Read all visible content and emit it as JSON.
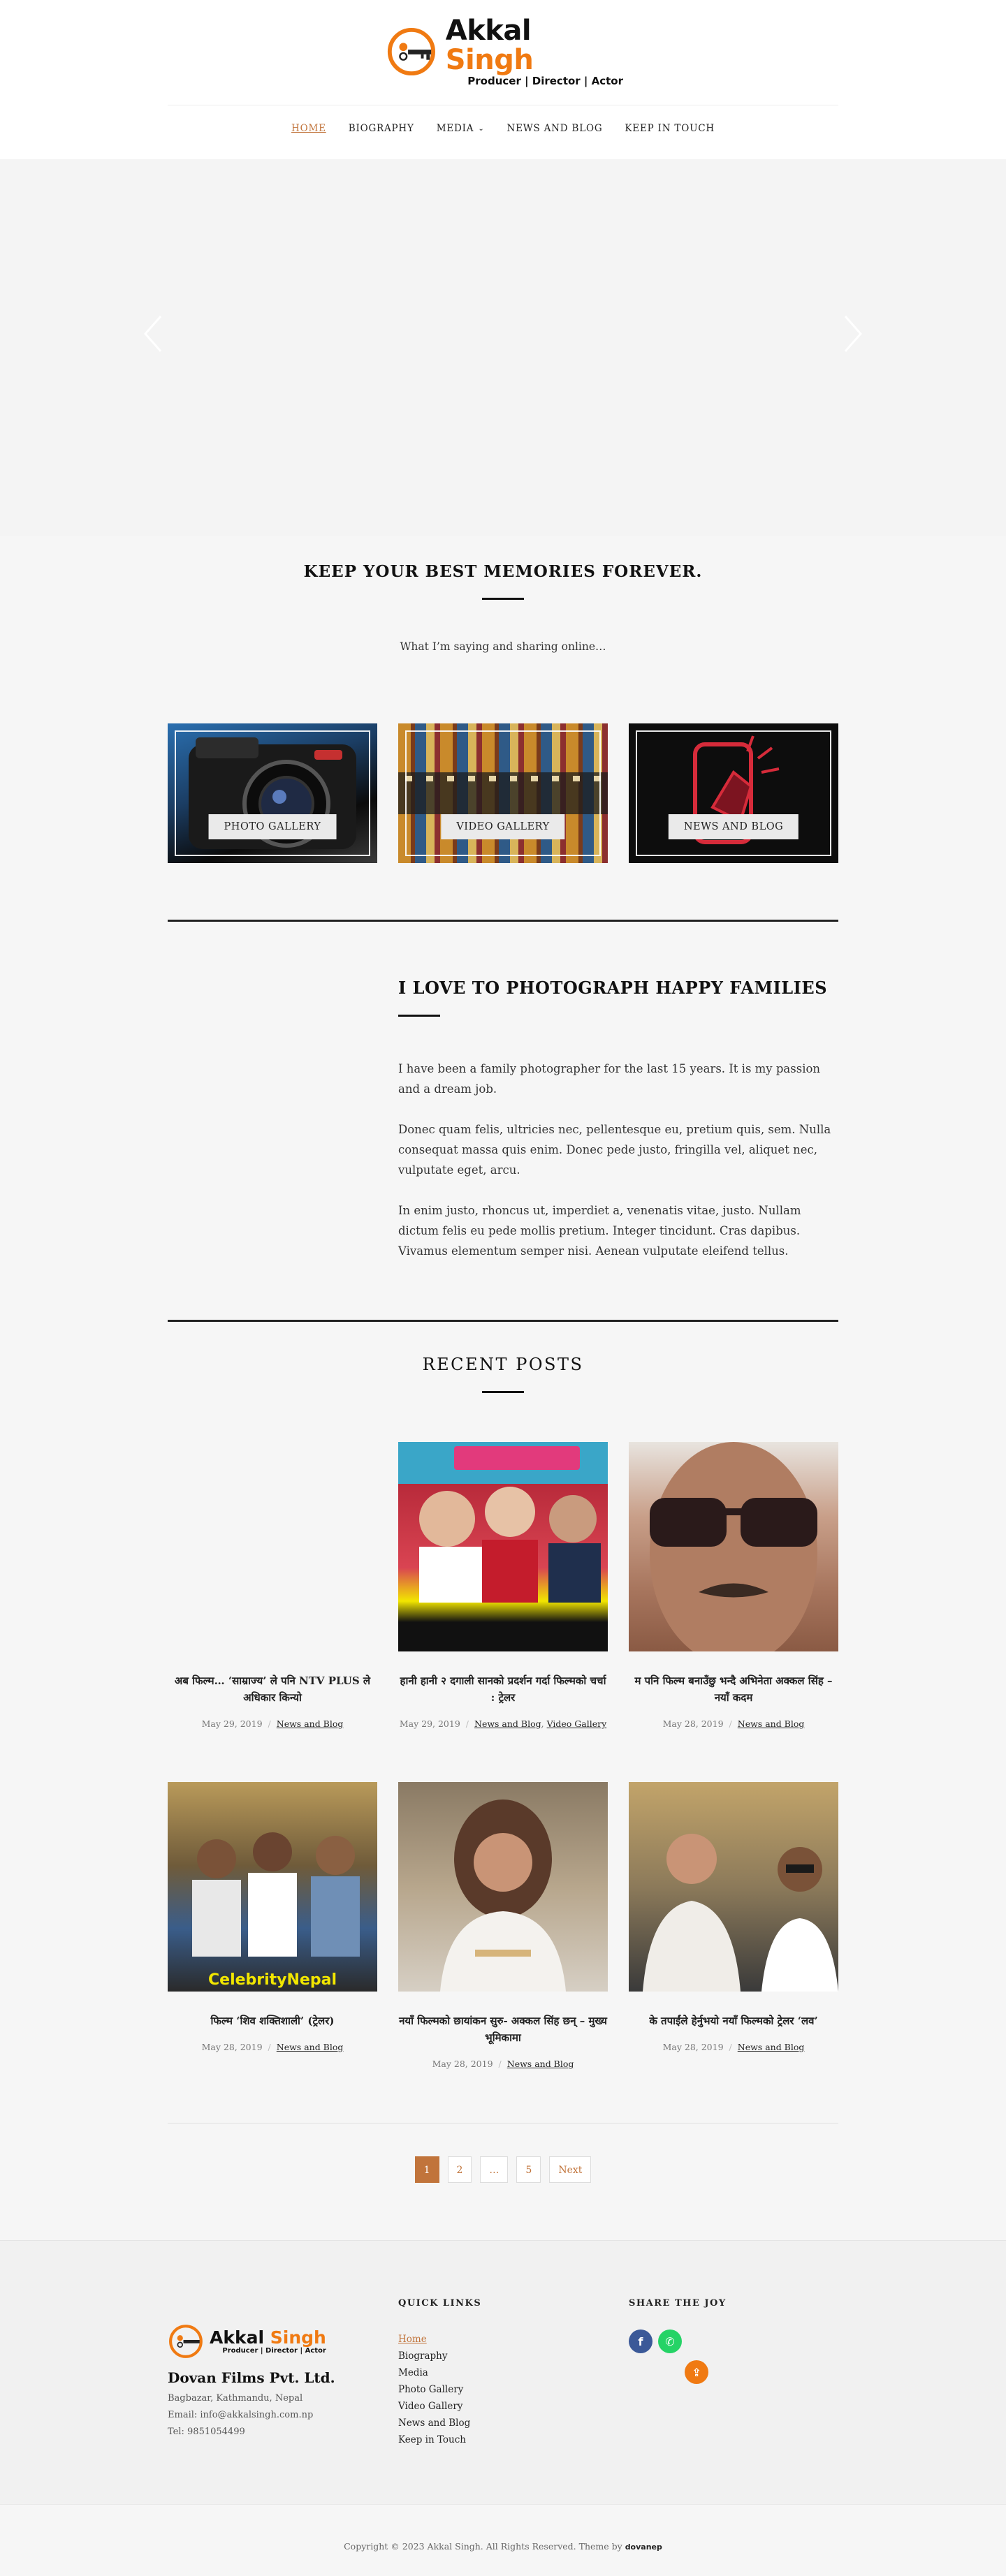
{
  "brand": {
    "name_part1": "Akkal",
    "name_part2": "Singh",
    "tagline": "Producer | Director | Actor",
    "accent_color": "#f07a12",
    "link_color": "#c1743b"
  },
  "nav": {
    "items": [
      {
        "label": "HOME",
        "active": true
      },
      {
        "label": "BIOGRAPHY"
      },
      {
        "label": "MEDIA",
        "has_dropdown": true
      },
      {
        "label": "NEWS AND BLOG"
      },
      {
        "label": "KEEP IN TOUCH"
      }
    ]
  },
  "memories": {
    "title": "KEEP YOUR BEST MEMORIES FOREVER.",
    "subtitle": "What I’m saying and sharing online…"
  },
  "tiles": [
    {
      "label": "PHOTO GALLERY"
    },
    {
      "label": "VIDEO GALLERY"
    },
    {
      "label": "NEWS AND BLOG"
    }
  ],
  "love": {
    "title": "I LOVE TO PHOTOGRAPH HAPPY FAMILIES",
    "paragraphs": [
      "I have been a family photographer for the last 15 years. It is my passion and a dream job.",
      "Donec quam felis, ultricies nec, pellentesque eu, pretium quis, sem. Nulla consequat massa quis enim. Donec pede justo, fringilla vel, aliquet nec, vulputate eget, arcu.",
      "In enim justo, rhoncus ut, imperdiet a, venenatis vitae, justo. Nullam dictum felis eu pede mollis pretium. Integer tincidunt. Cras dapibus. Vivamus elementum semper nisi. Aenean vulputate eleifend tellus."
    ]
  },
  "recent": {
    "title": "RECENT POSTS",
    "posts": [
      {
        "title": "अब फिल्म… ‘साम्राज्य’ ले पनि NTV PLUS ले अधिकार किन्यो",
        "date": "May 29, 2019",
        "cats": [
          "News and Blog"
        ]
      },
      {
        "title": "हानी हानी २ दगाली सानको प्रदर्शन गर्दा फिल्मको चर्चा : ट्रेलर",
        "date": "May 29, 2019",
        "cats": [
          "News and Blog",
          "Video Gallery"
        ]
      },
      {
        "title": "म पनि फिल्म बनाउँछु भन्दै अभिनेता अक्कल सिंह – नयाँ कदम",
        "date": "May 28, 2019",
        "cats": [
          "News and Blog"
        ]
      },
      {
        "title": "फिल्म ‘शिव शक्तिशाली’ (ट्रेलर)",
        "date": "May 28, 2019",
        "cats": [
          "News and Blog"
        ]
      },
      {
        "title": "नयाँ फिल्मको छायांकन सुरु- अक्कल सिंह छन् – मुख्य भूमिकामा",
        "date": "May 28, 2019",
        "cats": [
          "News and Blog"
        ]
      },
      {
        "title": "के तपाईंले हेर्नुभयो नयाँ फिल्मको ट्रेलर ‘लव’",
        "date": "May 28, 2019",
        "cats": [
          "News and Blog"
        ]
      }
    ]
  },
  "pagination": {
    "pages": [
      "1",
      "2",
      "…",
      "5"
    ],
    "current": "1",
    "next_label": "Next"
  },
  "footer": {
    "company": "Dovan Films Pvt. Ltd.",
    "address": "Bagbazar, Kathmandu, Nepal",
    "email": "Email: info@akkalsingh.com.np",
    "tel": "Tel: 9851054499",
    "quick_links_title": "QUICK LINKS",
    "quick_links": [
      "Home",
      "Biography",
      "Media",
      "Photo Gallery",
      "Video Gallery",
      "News and Blog",
      "Keep in Touch"
    ],
    "share_title": "SHARE THE JOY",
    "social": [
      {
        "icon": "facebook-icon",
        "glyph": "f",
        "color": "#3b5998"
      },
      {
        "icon": "whatsapp-icon",
        "glyph": "✆",
        "color": "#25d366"
      },
      {
        "icon": "share-icon",
        "glyph": "⇪",
        "color": "#f07a12"
      }
    ]
  },
  "copyright": {
    "text": "Copyright © 2023 Akkal Singh. All Rights Reserved. Theme by",
    "theme_brand": "dovanep"
  }
}
